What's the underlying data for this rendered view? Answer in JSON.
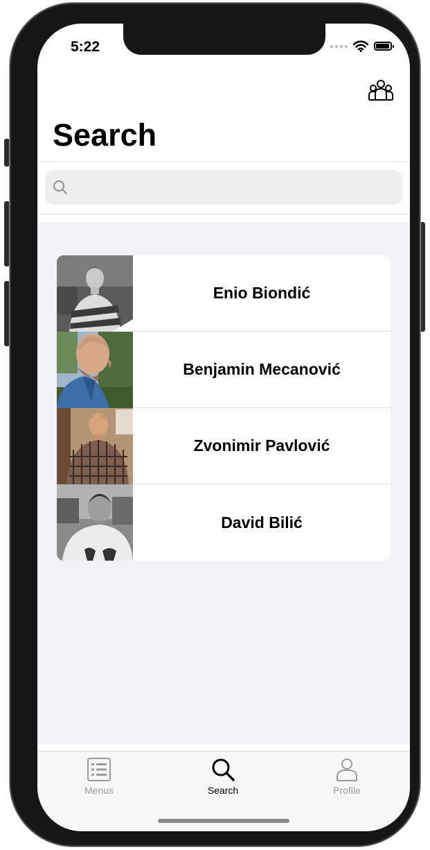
{
  "status_bar": {
    "time": "5:22"
  },
  "header": {
    "title": "Search",
    "right_icon": "people-group-icon"
  },
  "search": {
    "placeholder": "",
    "value": ""
  },
  "people": [
    {
      "name": "Enio Biondić"
    },
    {
      "name": "Benjamin Mecanović"
    },
    {
      "name": "Zvonimir Pavlović"
    },
    {
      "name": "David Bilić"
    }
  ],
  "tabbar": {
    "tabs": [
      {
        "label": "Menus",
        "icon": "menu-list-icon",
        "selected": false
      },
      {
        "label": "Search",
        "icon": "search-icon",
        "selected": true
      },
      {
        "label": "Profile",
        "icon": "profile-icon",
        "selected": false
      }
    ]
  },
  "colors": {
    "content_background": "#f1f1f6",
    "tab_active": "#000000",
    "tab_inactive": "#9a9a9a"
  }
}
